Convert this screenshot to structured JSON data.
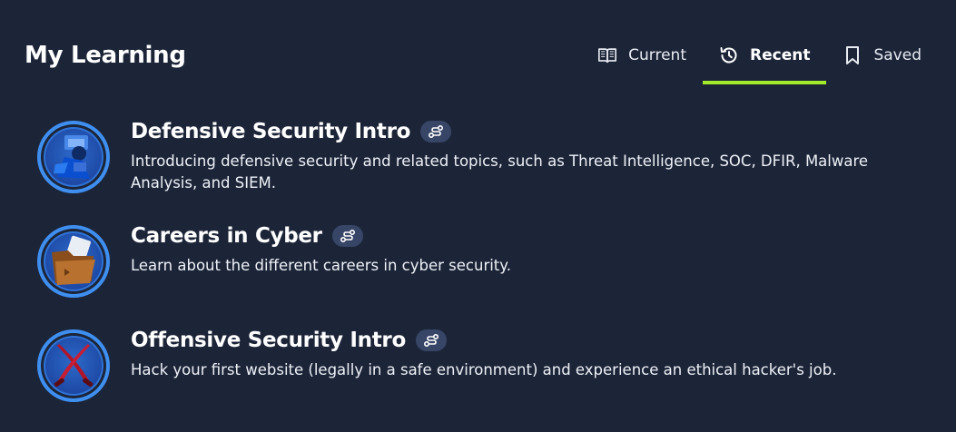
{
  "page": {
    "title": "My Learning"
  },
  "tabs": [
    {
      "label": "Current",
      "icon": "book-open-icon",
      "active": false
    },
    {
      "label": "Recent",
      "icon": "history-icon",
      "active": true
    },
    {
      "label": "Saved",
      "icon": "bookmark-icon",
      "active": false
    }
  ],
  "courses": [
    {
      "title": "Defensive Security Intro",
      "description": "Introducing defensive security and related topics, such as Threat Intelligence, SOC, DFIR, Malware Analysis, and SIEM.",
      "badge_icon": "defensive-security-badge-icon",
      "tag_icon": "learning-path-icon"
    },
    {
      "title": "Careers in Cyber",
      "description": "Learn about the different careers in cyber security.",
      "badge_icon": "careers-folder-badge-icon",
      "tag_icon": "learning-path-icon"
    },
    {
      "title": "Offensive Security Intro",
      "description": "Hack your first website (legally in a safe environment) and experience an ethical hacker's job.",
      "badge_icon": "crossed-swords-badge-icon",
      "tag_icon": "learning-path-icon"
    }
  ],
  "colors": {
    "background": "#1c2538",
    "accent": "#a3ea2a",
    "chip": "#374567",
    "badge_ring": "#3f8ff0"
  }
}
